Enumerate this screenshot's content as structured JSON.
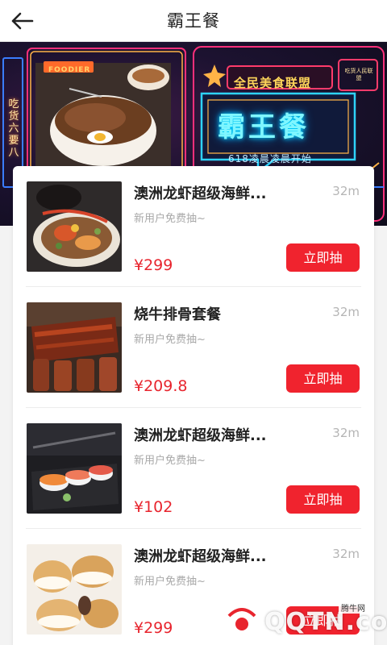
{
  "header": {
    "title": "霸王餐",
    "back_icon": "arrow-left-icon"
  },
  "banner": {
    "side_text": "吃货六要八",
    "foodier_label": "FOODIER",
    "alliance_text": "全民美食联盟",
    "main_text": "霸王餐",
    "sub_text": "618凌晨凌晨开始",
    "badge_text": "吃货人民联盟"
  },
  "items": [
    {
      "title": "澳洲龙虾超级海鲜...",
      "distance": "32m",
      "subtitle": "新用户免费抽~",
      "price": "¥299",
      "button": "立即抽",
      "image": "seafood-platter"
    },
    {
      "title": "烧牛排骨套餐",
      "distance": "32m",
      "subtitle": "新用户免费抽~",
      "price": "¥209.8",
      "button": "立即抽",
      "image": "bbq-ribs"
    },
    {
      "title": "澳洲龙虾超级海鲜...",
      "distance": "32m",
      "subtitle": "新用户免费抽~",
      "price": "¥102",
      "button": "立即抽",
      "image": "sushi"
    },
    {
      "title": "澳洲龙虾超级海鲜...",
      "distance": "32m",
      "subtitle": "新用户免费抽~",
      "price": "¥299",
      "button": "立即抽",
      "image": "cream-puffs"
    }
  ],
  "watermark": {
    "text": "QQTN.com",
    "small": "腾牛网"
  },
  "colors": {
    "accent": "#f0232e",
    "price": "#e8252e",
    "neon_cyan": "#7ff6ff"
  }
}
